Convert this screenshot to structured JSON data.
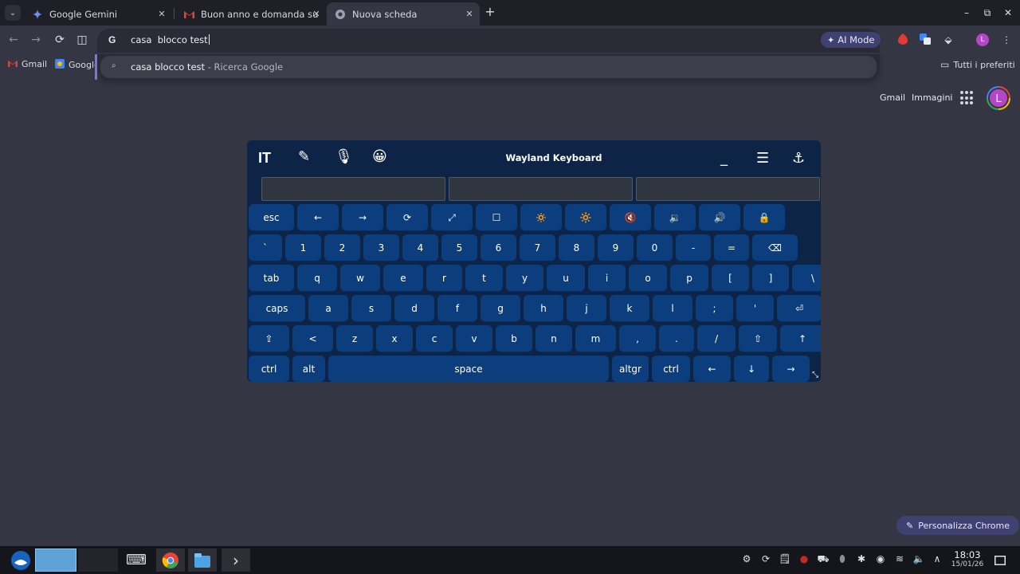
{
  "tabs": [
    {
      "title": "Google Gemini",
      "icon": "gemini-icon",
      "active": false
    },
    {
      "title": "Buon anno e domanda su",
      "icon": "gmail-icon",
      "active": false
    },
    {
      "title": "Nuova scheda",
      "icon": "chrome-icon",
      "active": true
    }
  ],
  "glyphs": {
    "tab_search": "⌄",
    "close": "✕",
    "new_tab": "+",
    "minimize": "–",
    "restore": "⧉",
    "win_close": "✕",
    "back": "←",
    "forward": "→",
    "reload": "⟳",
    "split": "◫",
    "google_g": "G",
    "ai_mode": "✦",
    "extension": "⬙",
    "menu": "⋮",
    "search": "⌕",
    "folder": "▭",
    "pencil": "✎",
    "mic": "🎙",
    "emoji": "😀",
    "kb_minimize": "_",
    "kb_menu": "☰",
    "kb_anchor": "⚓",
    "resize": "⤡"
  },
  "omnibox": {
    "value": "casa  blocco test"
  },
  "suggestion": {
    "query": "casa blocco test",
    "suffix": " - Ricerca Google"
  },
  "toolbar": {
    "ai_mode_label": "AI Mode",
    "profile_initial": "L"
  },
  "bookmarks": [
    {
      "label": "Gmail",
      "icon": "gmail-icon"
    },
    {
      "label": "Google",
      "icon": "google-icon"
    }
  ],
  "all_bookmarks_label": "Tutti i preferiti",
  "google_page": {
    "gmail": "Gmail",
    "images": "Immagini",
    "avatar_initial": "L",
    "customize_label": "Personalizza Chrome"
  },
  "keyboard": {
    "title": "Wayland Keyboard",
    "lang": "IT",
    "rows": [
      [
        "esc",
        "←",
        "→",
        "⟳",
        "⤢",
        "☐",
        "🔅",
        "🔆",
        "🔇",
        "🔉",
        "🔊",
        "🔒"
      ],
      [
        "`",
        "1",
        "2",
        "3",
        "4",
        "5",
        "6",
        "7",
        "8",
        "9",
        "0",
        "-",
        "=",
        "⌫"
      ],
      [
        "tab",
        "q",
        "w",
        "e",
        "r",
        "t",
        "y",
        "u",
        "i",
        "o",
        "p",
        "[",
        "]",
        "\\"
      ],
      [
        "caps",
        "a",
        "s",
        "d",
        "f",
        "g",
        "h",
        "j",
        "k",
        "l",
        ";",
        "'",
        "⏎"
      ],
      [
        "⇧",
        "<",
        "z",
        "x",
        "c",
        "v",
        "b",
        "n",
        "m",
        ",",
        ".",
        "/",
        "⇧",
        "↑"
      ],
      [
        "ctrl",
        "alt",
        "space",
        "altgr",
        "ctrl",
        "←",
        "↓",
        "→"
      ]
    ]
  },
  "taskbar": {
    "keyboard_icon": "⌨",
    "terminal_icon": "›",
    "tray": [
      "⚙",
      "⟳",
      "🗒",
      "●",
      "⛟",
      "⬮",
      "✱",
      "◉",
      "≋",
      "🔈",
      "∧"
    ],
    "time": "18:03",
    "date": "15/01/26"
  }
}
